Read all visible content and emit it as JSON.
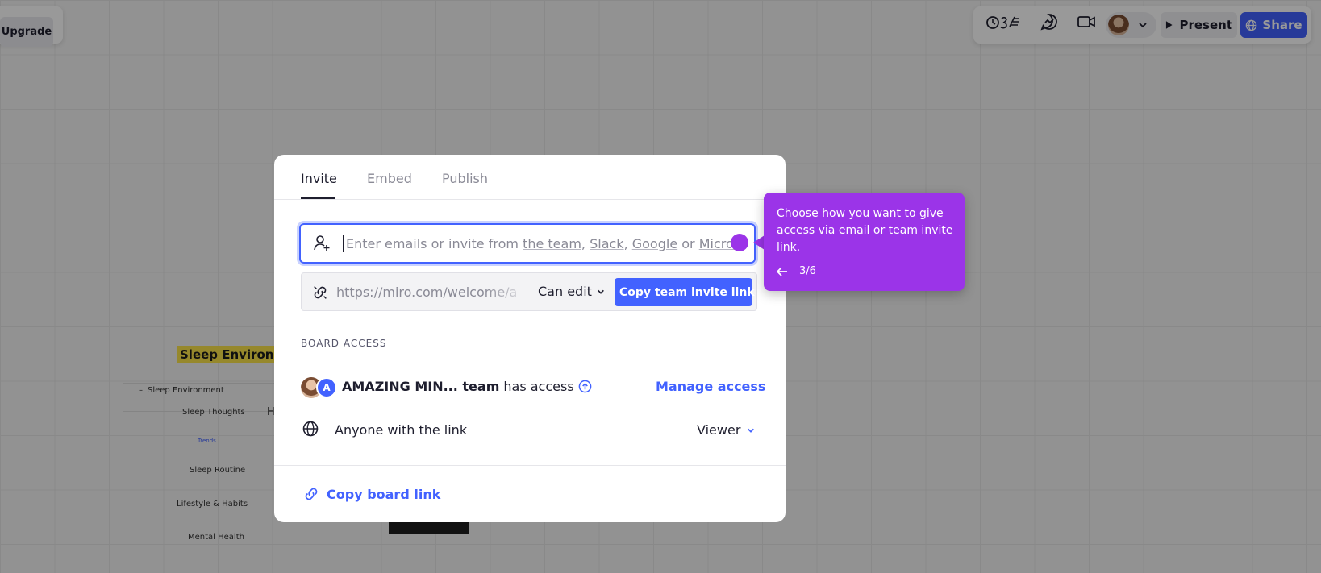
{
  "toolbar_left": {
    "upgrade_label": "Upgrade"
  },
  "toolbar_right": {
    "present_label": "Present",
    "share_label": "Share",
    "icons": [
      "reactions-icon",
      "chat-icon",
      "video-call-icon",
      "avatar",
      "chevron-down-icon"
    ]
  },
  "canvas": {
    "mindmap_title": "Sleep Environm",
    "nodes": [
      "Sleep Environment",
      "Sleep Thoughts",
      "Trends",
      "Sleep Routine",
      "Lifestyle & Habits",
      "Mental Health"
    ],
    "node_partial": "H"
  },
  "dialog": {
    "tabs": [
      "Invite",
      "Embed",
      "Publish"
    ],
    "active_tab": "Invite",
    "email_placeholder": {
      "prefix": "Enter emails or invite from ",
      "team": "the team",
      "sep1": ", ",
      "slack": "Slack",
      "sep2": ", ",
      "google": "Google",
      "sep3": " or ",
      "microsoft": "Microsoft"
    },
    "invite_link_url": "https://miro.com/welcome/a",
    "permission": "Can edit",
    "copy_invite_label": "Copy team invite link",
    "board_access_label": "BOARD ACCESS",
    "team_avatar_initial": "A",
    "team_name": "AMAZING MIN... team",
    "team_suffix": "has access",
    "manage_access_label": "Manage access",
    "anyone_label": "Anyone with the link",
    "anyone_role": "Viewer",
    "copy_board_link_label": "Copy board link"
  },
  "tooltip": {
    "text": "Choose how you want to give access via email or team invite link.",
    "step": "3/6"
  },
  "colors": {
    "accent": "#4262ff",
    "tooltip": "#9b34e8",
    "highlight": "#fbe34a"
  }
}
